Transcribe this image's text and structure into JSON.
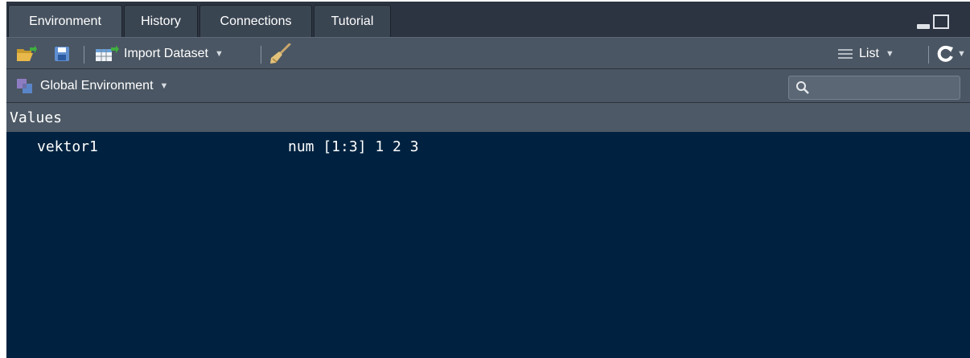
{
  "tabs": [
    {
      "label": "Environment",
      "active": true
    },
    {
      "label": "History",
      "active": false
    },
    {
      "label": "Connections",
      "active": false
    },
    {
      "label": "Tutorial",
      "active": false
    }
  ],
  "toolbar": {
    "open_icon": "folder-open-icon",
    "save_icon": "save-icon",
    "import_label": "Import Dataset",
    "clear_icon": "broom-icon",
    "view_label": "List",
    "refresh_icon": "refresh-icon"
  },
  "env_bar": {
    "environment_label": "Global Environment",
    "search_placeholder": ""
  },
  "section": {
    "title": "Values"
  },
  "variables": [
    {
      "name": "vektor1",
      "value": "num [1:3] 1 2 3"
    }
  ],
  "colors": {
    "pane_bg": "#002240",
    "tabbar_bg": "#2b3440",
    "toolbar_bg": "#4a5663"
  }
}
